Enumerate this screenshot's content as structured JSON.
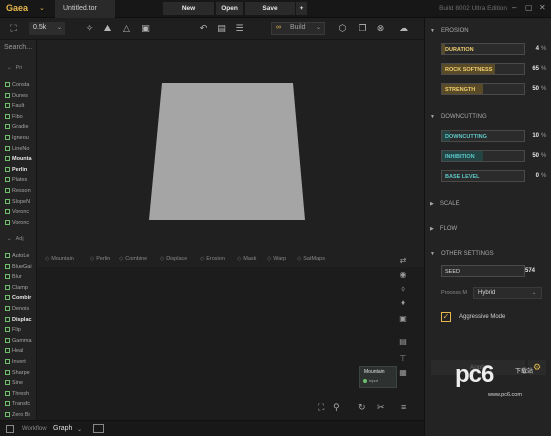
{
  "app": {
    "logo": "Gaea",
    "file_tab": "Untitled.tor",
    "menu": [
      "New",
      "Open",
      "Save",
      "+"
    ],
    "build_info": "Build 8002 Ultra Edition"
  },
  "toolbar": {
    "resolution": "0.5k",
    "build_label": "Build"
  },
  "sidebar": {
    "search_placeholder": "Search...",
    "section1": "Pri",
    "primitives": [
      "Consta",
      "Dunes",
      "Fault",
      "Fibo",
      "Gradie",
      "Igneou",
      "LineNo",
      "Mounta",
      "Perlin",
      "Plates",
      "Resson",
      "SlopeN",
      "Voronc",
      "Voronc"
    ],
    "section2": "Adj",
    "adjustments": [
      "AutoLe",
      "BlueGai",
      "Blur",
      "Clamp",
      "Combir",
      "Denois",
      "Displac",
      "Flip",
      "Gamma",
      "Heal",
      "Invert",
      "Sharpe",
      "Sine",
      "Thresh",
      "Transfc",
      "Zero Bi"
    ]
  },
  "node_strip": [
    "Mountain",
    "Perlin",
    "Combine",
    "Displace",
    "Erosion",
    "Mask",
    "Warp",
    "SatMaps"
  ],
  "mini_node": {
    "title": "Mountain",
    "port": "Input"
  },
  "bottom": {
    "workflow": "Workflow",
    "graph": "Graph"
  },
  "panel": {
    "erosion_title": "EROSION",
    "erosion_params": [
      {
        "label": "DURATION",
        "value": "4",
        "unit": "%",
        "fill": 0.04
      },
      {
        "label": "ROCK SOFTNESS",
        "value": "65",
        "unit": "%",
        "fill": 0.65
      },
      {
        "label": "STRENGTH",
        "value": "50",
        "unit": "%",
        "fill": 0.5
      }
    ],
    "downcutting_title": "DOWNCUTTING",
    "downcutting_params": [
      {
        "label": "DOWNCUTTING",
        "value": "10",
        "unit": "%",
        "fill": 0.1
      },
      {
        "label": "INHIBITION",
        "value": "50",
        "unit": "%",
        "fill": 0.5
      },
      {
        "label": "BASE LEVEL",
        "value": "0",
        "unit": "%",
        "fill": 0
      }
    ],
    "scale_title": "SCALE",
    "flow_title": "FLOW",
    "other_title": "OTHER SETTINGS",
    "seed_label": "SEED",
    "seed_value": "574",
    "process_label": "Process M",
    "process_value": "Hybrid",
    "aggressive_label": "Aggressive Mode",
    "apply_label": "Apply"
  },
  "watermark": {
    "brand": "pc6",
    "sub": "下载站",
    "url": "www.pc6.com"
  },
  "colors": {
    "accent": "#e6b84b",
    "teal": "#5dc8c8",
    "node_green": "#6dbf6b"
  }
}
